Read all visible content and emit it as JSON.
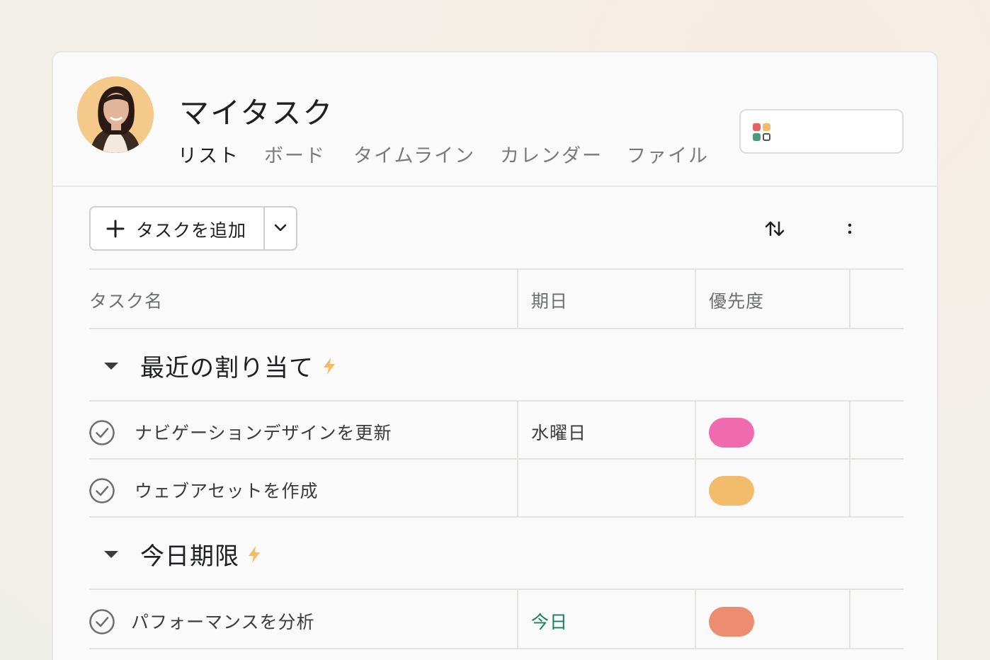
{
  "header": {
    "title": "マイタスク",
    "tabs": [
      {
        "label": "リスト",
        "active": true
      },
      {
        "label": "ボード"
      },
      {
        "label": "タイムライン"
      },
      {
        "label": "カレンダー"
      },
      {
        "label": "ファイル"
      }
    ]
  },
  "toolbar": {
    "add_task_label": "タスクを追加"
  },
  "table": {
    "columns": [
      "タスク名",
      "期日",
      "優先度"
    ]
  },
  "sections": [
    {
      "title": "最近の割り当て",
      "tasks": [
        {
          "name": "ナビゲーションデザインを更新",
          "due": "水曜日",
          "priority_color": "#f06aaf"
        },
        {
          "name": "ウェブアセットを作成",
          "due": "",
          "priority_color": "#f1bd6c"
        }
      ]
    },
    {
      "title": "今日期限",
      "tasks": [
        {
          "name": "パフォーマンスを分析",
          "due": "今日",
          "priority_color": "#ec8d71"
        }
      ]
    }
  ],
  "colors": {
    "due_today": "#1a7f5a",
    "bolt": "#f1bd6c",
    "app_icon_dots": [
      "#e8615d",
      "#f1bd6c",
      "#4c9a78",
      "#555555"
    ]
  }
}
